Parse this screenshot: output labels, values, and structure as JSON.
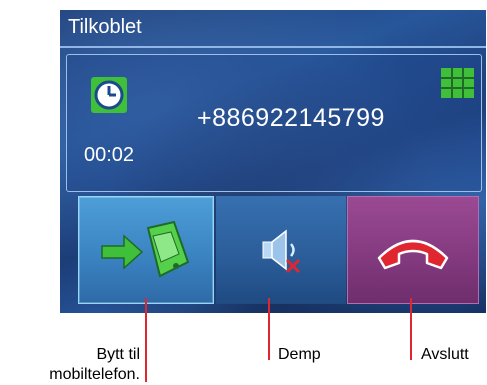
{
  "screen": {
    "title": "Tilkoblet",
    "call_timer": "00:02",
    "phone_number": "+886922145799",
    "icons": {
      "clock": "clock-icon",
      "keypad": "keypad-grid-icon"
    }
  },
  "buttons": {
    "switch_to_mobile": {
      "icon": "phone-transfer-icon"
    },
    "mute": {
      "icon": "speaker-muted-icon"
    },
    "end_call": {
      "icon": "hang-up-icon"
    }
  },
  "callouts": {
    "switch_line1": "Bytt til",
    "switch_line2": "mobiltelefon.",
    "mute": "Demp",
    "end_call": "Avslutt"
  },
  "colors": {
    "accent_green": "#3fbf3a",
    "end_call_red": "#e0262e",
    "pointer_red": "#e0262e"
  }
}
